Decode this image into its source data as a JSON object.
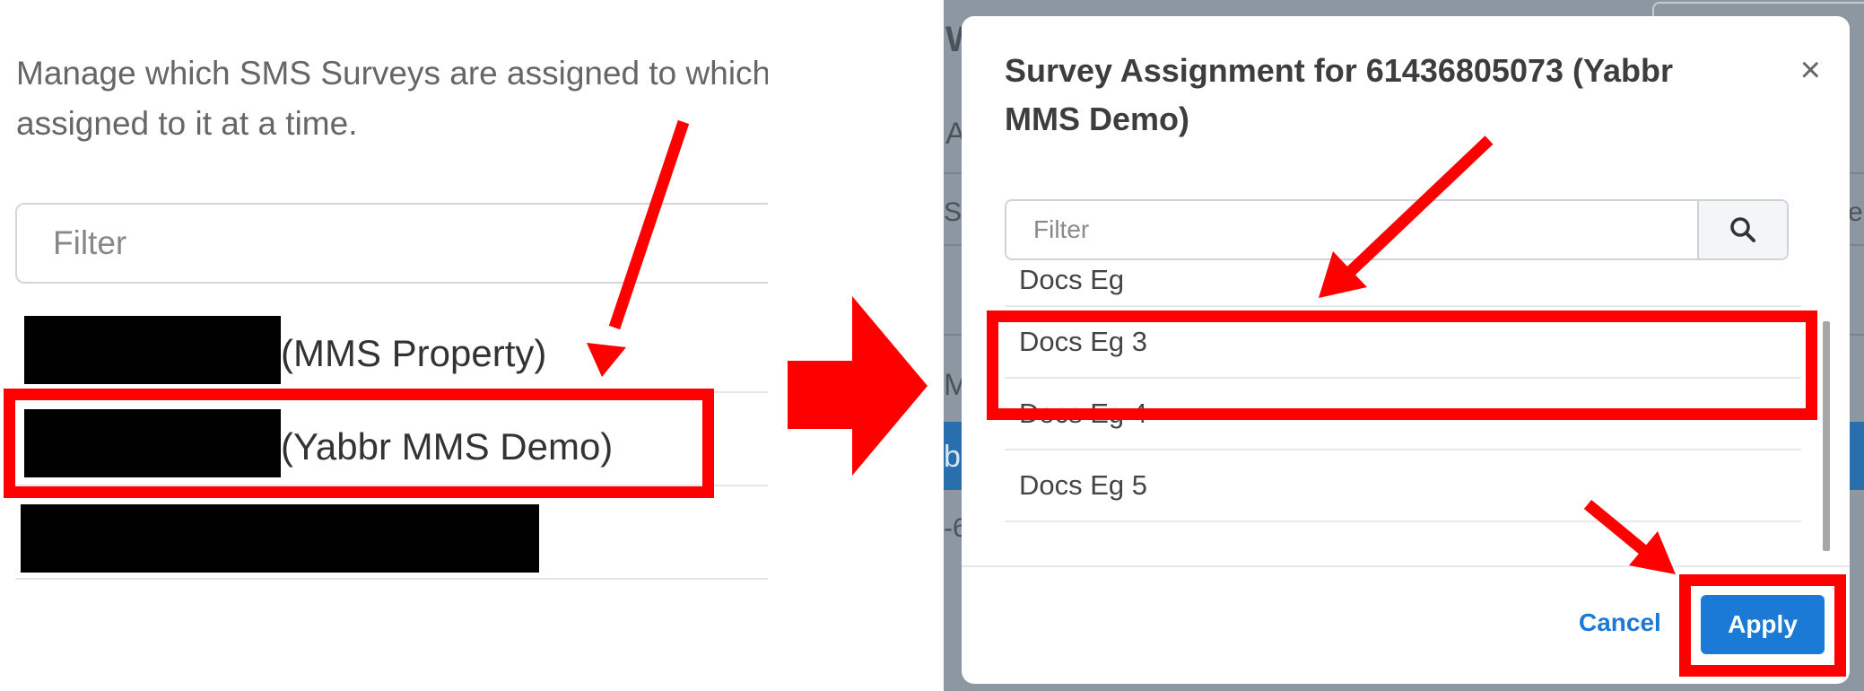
{
  "left": {
    "description": "Manage which SMS Surveys are assigned to which\nassigned to it at a time.",
    "filter_placeholder": "Filter",
    "rows": [
      {
        "label": "(MMS Property)"
      },
      {
        "label": "(Yabbr MMS Demo)"
      }
    ]
  },
  "background_fragments": {
    "a": "W",
    "b": "A",
    "c": "Su",
    "d": "e",
    "e": "M",
    "f": "b",
    "g": "-6"
  },
  "modal": {
    "title": "Survey Assignment for 61436805073 (Yabbr MMS Demo)",
    "close_symbol": "×",
    "filter_placeholder": "Filter",
    "items": [
      {
        "label": "Docs Eg"
      },
      {
        "label": "Docs Eg 3"
      },
      {
        "label": "Docs Eg 4"
      },
      {
        "label": "Docs Eg 5"
      }
    ],
    "cancel_label": "Cancel",
    "apply_label": "Apply",
    "search_icon": "magnifier-icon"
  },
  "colors": {
    "annotation_red": "#ff0000",
    "primary_blue": "#1a7ad6",
    "backdrop_gray": "#8d97a1"
  }
}
